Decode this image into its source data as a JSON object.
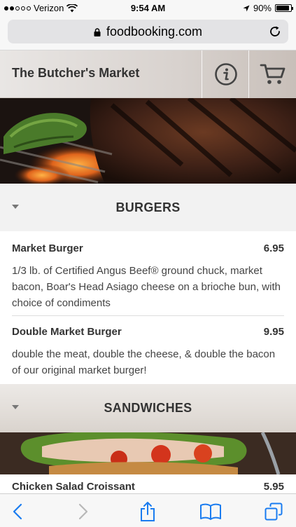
{
  "status_bar": {
    "carrier": "Verizon",
    "time": "9:54 AM",
    "battery": "90%",
    "battery_level": 0.9
  },
  "browser": {
    "url": "foodbooking.com"
  },
  "header": {
    "restaurant_name": "The Butcher's Market"
  },
  "categories": [
    {
      "title": "BURGERS",
      "items": [
        {
          "name": "Market Burger",
          "price": "6.95",
          "description": "1/3 lb. of Certified Angus Beef® ground chuck, market bacon, Boar's Head Asiago cheese on a brioche bun, with choice of condiments"
        },
        {
          "name": "Double Market Burger",
          "price": "9.95",
          "description": "double the meat, double the cheese, & double the bacon of our original market burger!"
        }
      ]
    },
    {
      "title": "SANDWICHES",
      "items": [
        {
          "name": "Chicken Salad Croissant",
          "price": "5.95"
        }
      ]
    }
  ],
  "colors": {
    "ios_blue": "#1a7cf0",
    "text": "#333333",
    "category_band": "#f2f2f2"
  },
  "icons": [
    "lock-icon",
    "reload-icon",
    "info-icon",
    "cart-icon",
    "back-icon",
    "forward-icon",
    "share-icon",
    "bookmarks-icon",
    "tabs-icon",
    "location-icon",
    "wifi-icon"
  ]
}
